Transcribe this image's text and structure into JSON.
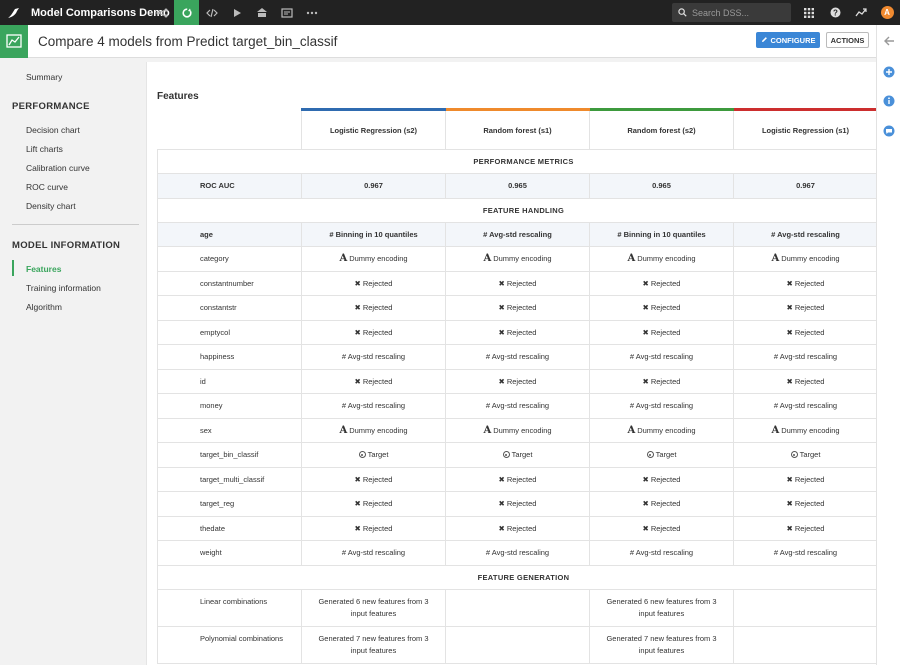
{
  "topbar": {
    "project_name": "Model Comparisons Demo",
    "search_placeholder": "Search DSS...",
    "avatar_letter": "A",
    "nav_icons": [
      "flow-icon",
      "refresh-icon",
      "code-icon",
      "play-icon",
      "dashboard-icon",
      "notebook-icon",
      "more-icon"
    ]
  },
  "header": {
    "title": "Compare 4 models from Predict target_bin_classif",
    "configure_label": "CONFIGURE",
    "actions_label": "ACTIONS"
  },
  "sidebar": {
    "summary": "Summary",
    "performance_heading": "PERFORMANCE",
    "performance_items": [
      "Decision chart",
      "Lift charts",
      "Calibration curve",
      "ROC curve",
      "Density chart"
    ],
    "model_info_heading": "MODEL INFORMATION",
    "model_info_items": [
      "Features",
      "Training information",
      "Algorithm"
    ],
    "active_item": "Features"
  },
  "main": {
    "section_title": "Features",
    "models": [
      {
        "name": "Logistic Regression (s2)",
        "color": "#2f6bb0"
      },
      {
        "name": "Random forest (s1)",
        "color": "#ef8a2c"
      },
      {
        "name": "Random forest (s2)",
        "color": "#3d9a3d"
      },
      {
        "name": "Logistic Regression (s1)",
        "color": "#cc2e2e"
      }
    ],
    "performance_section": "PERFORMANCE METRICS",
    "roc_label": "ROC AUC",
    "roc_values": [
      "0.967",
      "0.965",
      "0.965",
      "0.967"
    ],
    "feature_handling_section": "FEATURE HANDLING",
    "features": [
      {
        "name": "age",
        "cells": [
          "# Binning in 10 quantiles",
          "# Avg-std rescaling",
          "# Binning in 10 quantiles",
          "# Avg-std rescaling"
        ]
      },
      {
        "name": "category",
        "cells": [
          "Dummy encoding",
          "Dummy encoding",
          "Dummy encoding",
          "Dummy encoding"
        ]
      },
      {
        "name": "constantnumber",
        "cells": [
          "Rejected",
          "Rejected",
          "Rejected",
          "Rejected"
        ]
      },
      {
        "name": "constantstr",
        "cells": [
          "Rejected",
          "Rejected",
          "Rejected",
          "Rejected"
        ]
      },
      {
        "name": "emptycol",
        "cells": [
          "Rejected",
          "Rejected",
          "Rejected",
          "Rejected"
        ]
      },
      {
        "name": "happiness",
        "cells": [
          "# Avg-std rescaling",
          "# Avg-std rescaling",
          "# Avg-std rescaling",
          "# Avg-std rescaling"
        ]
      },
      {
        "name": "id",
        "cells": [
          "Rejected",
          "Rejected",
          "Rejected",
          "Rejected"
        ]
      },
      {
        "name": "money",
        "cells": [
          "# Avg-std rescaling",
          "# Avg-std rescaling",
          "# Avg-std rescaling",
          "# Avg-std rescaling"
        ]
      },
      {
        "name": "sex",
        "cells": [
          "Dummy encoding",
          "Dummy encoding",
          "Dummy encoding",
          "Dummy encoding"
        ]
      },
      {
        "name": "target_bin_classif",
        "cells": [
          "Target",
          "Target",
          "Target",
          "Target"
        ]
      },
      {
        "name": "target_multi_classif",
        "cells": [
          "Rejected",
          "Rejected",
          "Rejected",
          "Rejected"
        ]
      },
      {
        "name": "target_reg",
        "cells": [
          "Rejected",
          "Rejected",
          "Rejected",
          "Rejected"
        ]
      },
      {
        "name": "thedate",
        "cells": [
          "Rejected",
          "Rejected",
          "Rejected",
          "Rejected"
        ]
      },
      {
        "name": "weight",
        "cells": [
          "# Avg-std rescaling",
          "# Avg-std rescaling",
          "# Avg-std rescaling",
          "# Avg-std rescaling"
        ]
      }
    ],
    "feature_generation_section": "FEATURE GENERATION",
    "generation": [
      {
        "name": "Linear combinations",
        "cells": [
          "Generated 6 new features from 3 input features",
          "",
          "Generated 6 new features from 3 input features",
          ""
        ]
      },
      {
        "name": "Polynomial combinations",
        "cells": [
          "Generated 7 new features from 3 input features",
          "",
          "Generated 7 new features from 3 input features",
          ""
        ]
      }
    ]
  }
}
